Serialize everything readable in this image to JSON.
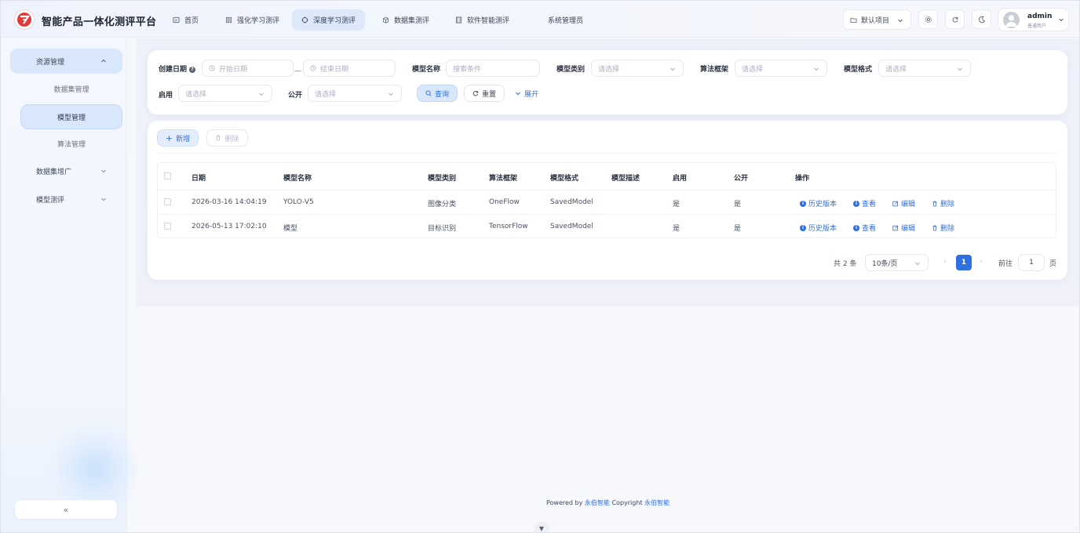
{
  "header": {
    "brand": "智能产品一体化测评平台",
    "nav": [
      {
        "label": "首页",
        "icon": "home-icon"
      },
      {
        "label": "强化学习测评",
        "icon": "grid-icon"
      },
      {
        "label": "深度学习测评",
        "icon": "target-icon",
        "active": true
      },
      {
        "label": "数据集测评",
        "icon": "box-icon"
      },
      {
        "label": "软件智能测评",
        "icon": "film-icon"
      },
      {
        "label": "系统管理员",
        "icon": ""
      }
    ],
    "project": "默认项目",
    "user": {
      "name": "admin",
      "role": "普通用户"
    }
  },
  "sidebar": {
    "groups": [
      {
        "label": "资源管理",
        "open": true,
        "children": [
          {
            "label": "数据集管理"
          },
          {
            "label": "模型管理",
            "active": true
          },
          {
            "label": "算法管理"
          }
        ]
      },
      {
        "label": "数据集增广",
        "open": false
      },
      {
        "label": "模型测评",
        "open": false
      }
    ],
    "collapse_label": "«"
  },
  "filters": {
    "create_date_label": "创建日期",
    "start_placeholder": "开始日期",
    "range_sep": "—",
    "end_placeholder": "结束日期",
    "model_name_label": "模型名称",
    "model_name_placeholder": "搜索条件",
    "model_type_label": "模型类别",
    "model_type_placeholder": "请选择",
    "framework_label": "算法框架",
    "framework_placeholder": "请选择",
    "format_label": "模型格式",
    "format_placeholder": "请选择",
    "enabled_label": "启用",
    "enabled_placeholder": "请选择",
    "public_label": "公开",
    "public_placeholder": "请选择",
    "query_label": "查询",
    "reset_label": "重置",
    "expand_label": "展开"
  },
  "toolbar": {
    "add_label": "新增",
    "delete_label": "删除"
  },
  "table": {
    "columns": [
      "日期",
      "模型名称",
      "模型类别",
      "算法框架",
      "模型格式",
      "模型描述",
      "启用",
      "公开",
      "操作"
    ],
    "rows": [
      {
        "date": "2026-03-16 14:04:19",
        "name": "YOLO-V5",
        "type": "图像分类",
        "framework": "OneFlow",
        "format": "SavedModel",
        "desc": "",
        "enabled": "是",
        "public": "是"
      },
      {
        "date": "2026-05-13 17:02:10",
        "name": "模型",
        "type": "目标识别",
        "framework": "TensorFlow",
        "format": "SavedModel",
        "desc": "",
        "enabled": "是",
        "public": "是"
      }
    ],
    "actions": {
      "history": "历史版本",
      "view": "查看",
      "edit": "编辑",
      "delete": "删除"
    }
  },
  "pagination": {
    "total": "共 2 条",
    "page_size": "10条/页",
    "current": "1",
    "goto_label": "前往",
    "goto_value": "1",
    "unit": "页"
  },
  "footer": {
    "powered_by": "Powered by",
    "company": "永伯智能",
    "copyright": "Copyright",
    "company2": "永伯智能"
  },
  "colors": {
    "accent": "#2f6fe0",
    "active_bg": "#d9e7fb"
  }
}
